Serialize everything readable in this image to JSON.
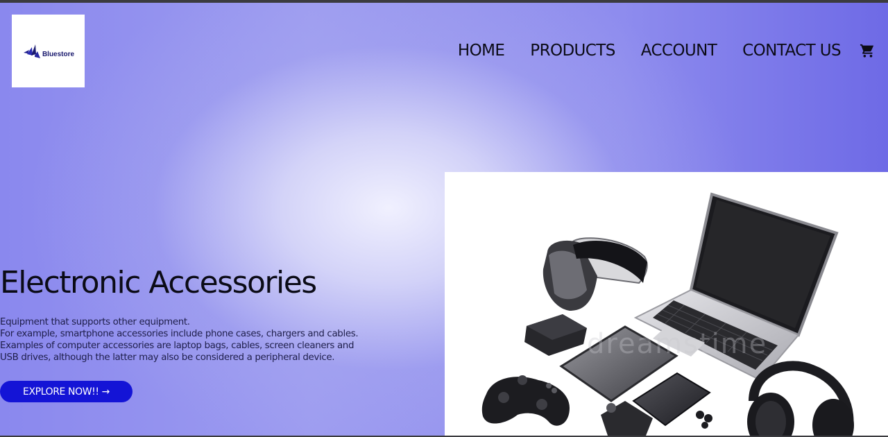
{
  "brand": {
    "logo_text": "Bluestore",
    "accent_color": "#1414d6"
  },
  "nav": {
    "items": [
      {
        "label": "HOME"
      },
      {
        "label": "PRODUCTS"
      },
      {
        "label": "ACCOUNT"
      },
      {
        "label": "CONTACT US"
      }
    ],
    "cart_icon": "shopping-cart-icon"
  },
  "hero": {
    "title": "Electronic Accessories",
    "description_lines": [
      "Equipment that supports other equipment.",
      "For example, smartphone accessories include phone cases, chargers and cables.",
      "Examples of computer accessories are laptop bags, cables, screen cleaners and",
      "USB drives, although the latter may also be considered a peripheral device."
    ],
    "cta_label": "EXPLORE NOW!! →",
    "image": {
      "watermark": "dreamstime"
    }
  }
}
